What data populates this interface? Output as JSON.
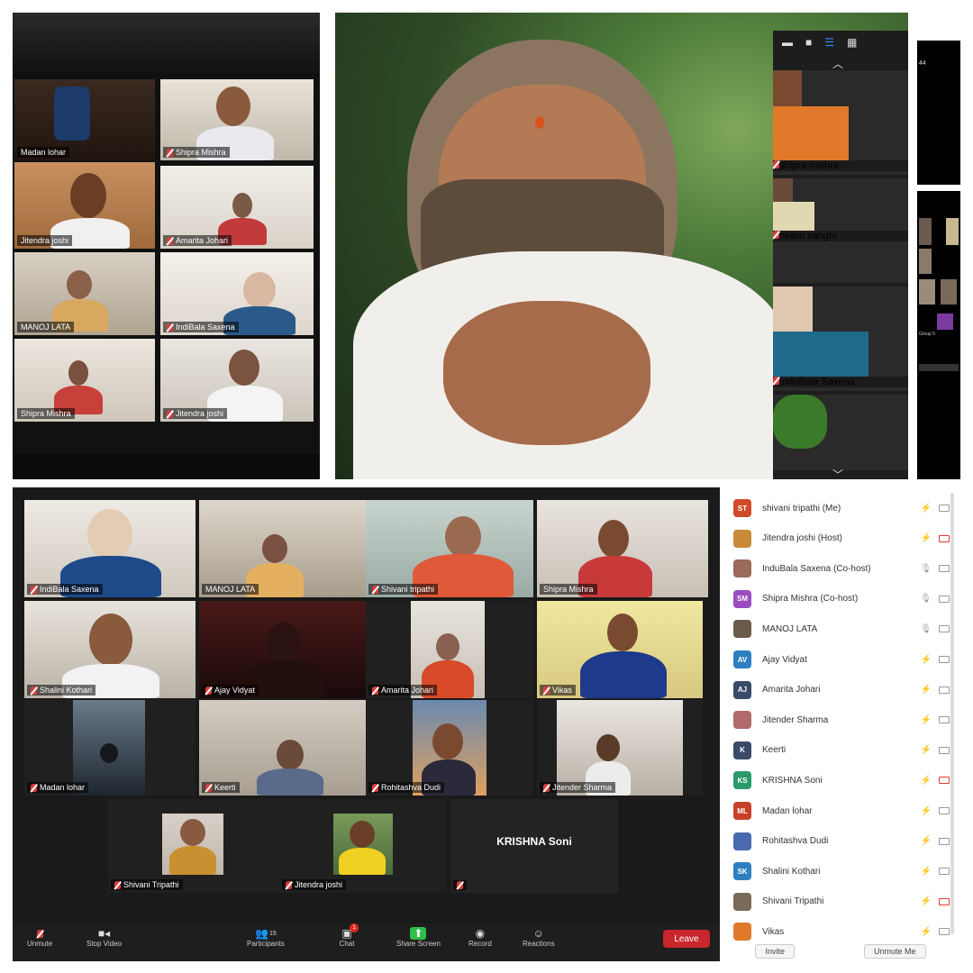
{
  "panel_a": {
    "tiles": [
      {
        "name": "Madan lohar",
        "mic_off": false,
        "highlight": false
      },
      {
        "name": "Shipra Mishra",
        "mic_off": true,
        "highlight": false
      },
      {
        "name": "Jitendra joshi",
        "mic_off": false,
        "highlight": true
      },
      {
        "name": "Amarita Johari",
        "mic_off": true,
        "highlight": false
      },
      {
        "name": "MANOJ LATA",
        "mic_off": false,
        "highlight": false
      },
      {
        "name": "IndiBala Saxena",
        "mic_off": true,
        "highlight": false
      },
      {
        "name": "Shipra Mishra",
        "mic_off": false,
        "highlight": false
      },
      {
        "name": "Jitendra joshi",
        "mic_off": true,
        "highlight": false
      }
    ]
  },
  "panel_b": {
    "view_icons": [
      "minimize-icon",
      "speaker-view-icon",
      "strip-view-icon",
      "grid-view-icon"
    ],
    "strip": [
      {
        "name": "shipra mishra"
      },
      {
        "name": "neeru sanghi"
      },
      {
        "name": "InduBala Saxena"
      },
      {
        "name": ""
      }
    ]
  },
  "panel_c": {
    "label": "44",
    "thumb_label": "Group 5"
  },
  "gallery": {
    "tiles": [
      {
        "name": "IndiBala Saxena"
      },
      {
        "name": "MANOJ LATA"
      },
      {
        "name": "Shivani tripathi"
      },
      {
        "name": "Shipra Mishra"
      },
      {
        "name": "Shalini Kothari"
      },
      {
        "name": "Ajay Vidyat"
      },
      {
        "name": "Amarita Johari"
      },
      {
        "name": "Vikas"
      },
      {
        "name": "Madan lohar"
      },
      {
        "name": "Keerti"
      },
      {
        "name": "Rohitashva Dudi"
      },
      {
        "name": "Jitender Sharma"
      },
      {
        "name": "Shivani Tripathi"
      },
      {
        "name": "Jitendra joshi"
      },
      {
        "name": "KRISHNA Soni"
      }
    ],
    "toolbar": {
      "unmute": "Unmute",
      "stop_video": "Stop Video",
      "participants": "Participants",
      "participants_count": "15",
      "chat": "Chat",
      "chat_badge": "1",
      "share_screen": "Share Screen",
      "record": "Record",
      "reactions": "Reactions",
      "leave": "Leave"
    }
  },
  "participants": {
    "rows": [
      {
        "initials": "ST",
        "name": "shivani tripathi (Me)",
        "color": "#d04a2a",
        "mic": "off",
        "cam": "off"
      },
      {
        "initials": "",
        "name": "Jitendra joshi (Host)",
        "color": "#c98a3a",
        "mic": "off",
        "cam": "off-red"
      },
      {
        "initials": "",
        "name": "InduBala Saxena (Co-host)",
        "color": "#9a6a5a",
        "mic": "on",
        "cam": "off"
      },
      {
        "initials": "SM",
        "name": "Shipra Mishra (Co-host)",
        "color": "#9b4dc0",
        "mic": "on",
        "cam": "off"
      },
      {
        "initials": "",
        "name": "MANOJ LATA",
        "color": "#6a5a4a",
        "mic": "on",
        "cam": "off"
      },
      {
        "initials": "AV",
        "name": "Ajay Vidyat",
        "color": "#2e7fc1",
        "mic": "off",
        "cam": "off"
      },
      {
        "initials": "AJ",
        "name": "Amarita Johari",
        "color": "#3a4a6a",
        "mic": "off",
        "cam": "off"
      },
      {
        "initials": "",
        "name": "Jitender Sharma",
        "color": "#b06a6a",
        "mic": "off",
        "cam": "off"
      },
      {
        "initials": "K",
        "name": "Keerti",
        "color": "#3a4a6a",
        "mic": "off",
        "cam": "off"
      },
      {
        "initials": "KS",
        "name": "KRISHNA Soni",
        "color": "#2a9a6a",
        "mic": "off",
        "cam": "off-red"
      },
      {
        "initials": "ML",
        "name": "Madan lohar",
        "color": "#c8402a",
        "mic": "off",
        "cam": "off"
      },
      {
        "initials": "",
        "name": "Rohitashva Dudi",
        "color": "#4a6ab0",
        "mic": "off",
        "cam": "off"
      },
      {
        "initials": "SK",
        "name": "Shalini Kothari",
        "color": "#2e7fc1",
        "mic": "off",
        "cam": "off"
      },
      {
        "initials": "",
        "name": "Shivani Tripathi",
        "color": "#7a6a5a",
        "mic": "off",
        "cam": "off-red"
      },
      {
        "initials": "",
        "name": "Vikas",
        "color": "#e07a2a",
        "mic": "off",
        "cam": "off"
      }
    ],
    "invite": "Invite",
    "unmute_me": "Unmute Me"
  }
}
